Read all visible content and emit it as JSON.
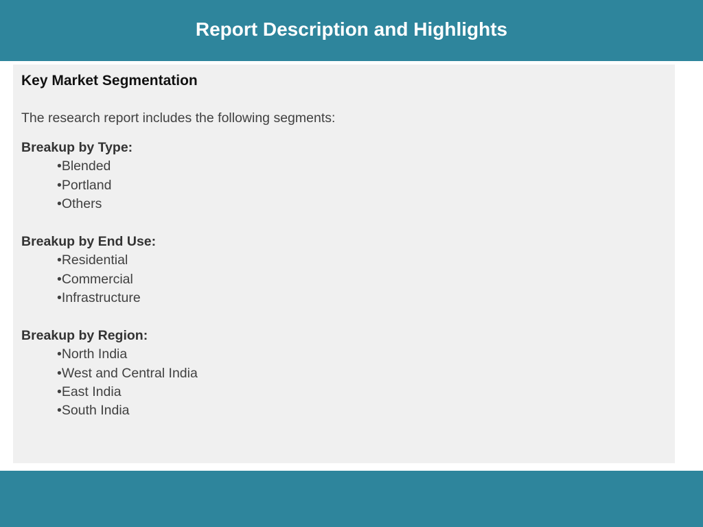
{
  "title": "Report Description and Highlights",
  "section": {
    "heading": "Key Market Segmentation",
    "intro": "The research report includes the following segments:"
  },
  "segments": [
    {
      "title": "Breakup by Type:",
      "items": [
        "Blended",
        "Portland",
        "Others"
      ]
    },
    {
      "title": "Breakup by End Use:",
      "items": [
        "Residential",
        "Commercial",
        "Infrastructure"
      ]
    },
    {
      "title": "Breakup by Region:",
      "items": [
        "North India",
        "West and Central India",
        "East India",
        "South India"
      ]
    }
  ],
  "colors": {
    "header_bar": "#2e859c",
    "content_background": "#f0f0f0"
  }
}
